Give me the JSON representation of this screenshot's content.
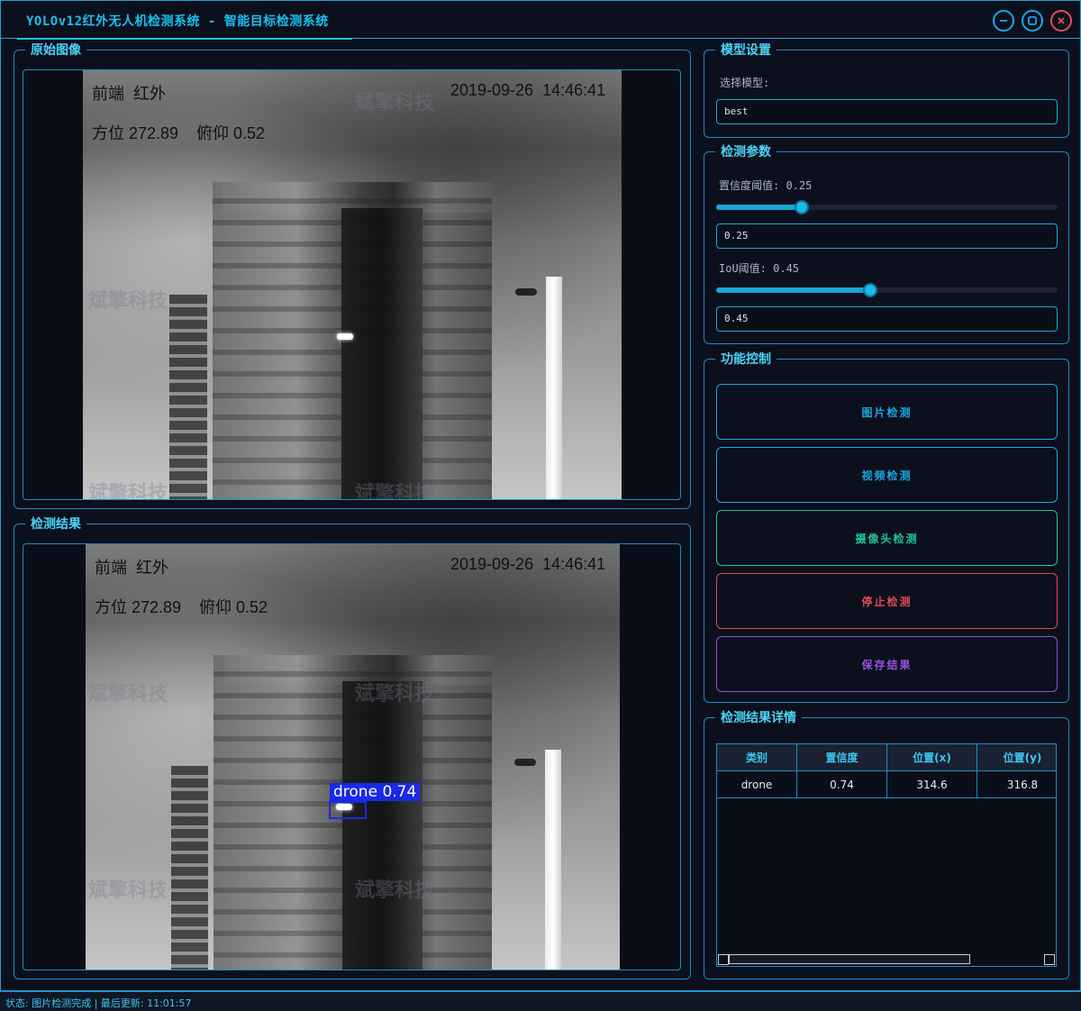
{
  "window": {
    "title": "YOLOv12红外无人机检测系统 - 智能目标检测系统",
    "buttons": {
      "minimize": "minimize-icon",
      "maximize": "maximize-icon",
      "close": "close-icon"
    }
  },
  "original": {
    "title": "原始图像",
    "overlay": {
      "top_left": "前端  红外",
      "timestamp": "2019-09-26  14:46:41",
      "azimuth": "方位 272.89",
      "pitch": "俯仰 0.52"
    },
    "watermark": "斌擎科技"
  },
  "result": {
    "title": "检测结果",
    "overlay": {
      "top_left": "前端  红外",
      "timestamp": "2019-09-26  14:46:41",
      "azimuth": "方位 272.89",
      "pitch": "俯仰 0.52"
    },
    "detection_label": "drone  0.74",
    "watermark": "斌擎科技"
  },
  "model": {
    "title": "模型设置",
    "select_label": "选择模型:",
    "selected": "best"
  },
  "params": {
    "title": "检测参数",
    "conf_label": "置信度阈值: 0.25",
    "conf_value": 0.25,
    "conf_input": "0.25",
    "iou_label": "IoU阈值: 0.45",
    "iou_value": 0.45,
    "iou_input": "0.45"
  },
  "controls": {
    "title": "功能控制",
    "image_detect": "图片检测",
    "video_detect": "视频检测",
    "camera_detect": "摄像头检测",
    "stop_detect": "停止检测",
    "save_results": "保存结果",
    "colors": {
      "image": "#1aa9e6",
      "video": "#1aa9e6",
      "camera": "#1fc69a",
      "stop": "#e04b57",
      "save": "#9a4fe0"
    }
  },
  "details": {
    "title": "检测结果详情",
    "columns": [
      "类别",
      "置信度",
      "位置(x)",
      "位置(y)"
    ],
    "rows": [
      [
        "drone",
        "0.74",
        "314.6",
        "316.8"
      ]
    ]
  },
  "status": {
    "text": "状态: 图片检测完成 | 最后更新: 11:01:57"
  }
}
